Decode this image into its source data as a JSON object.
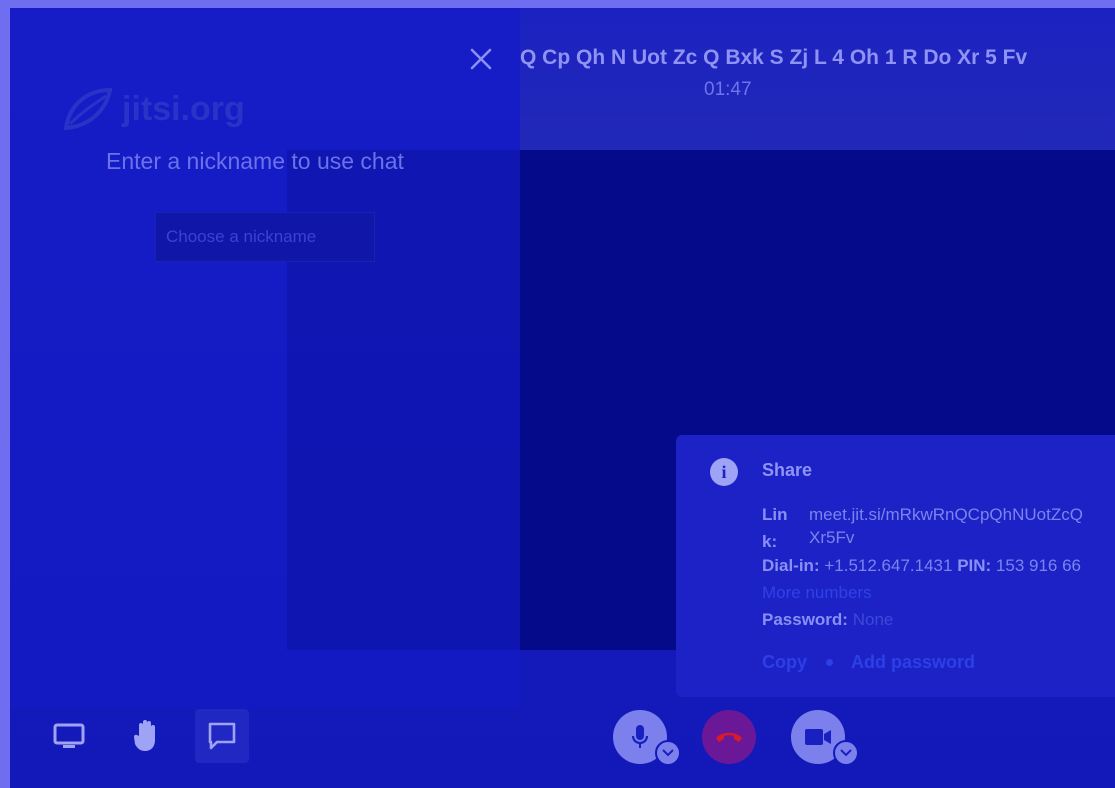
{
  "chat": {
    "logo_text": "jitsi.org",
    "heading": "Enter a nickname to use chat",
    "nickname_placeholder": "Choose a nickname"
  },
  "header": {
    "room_name": "Q Cp Qh N Uot Zc Q Bxk S Zj L 4 Oh 1 R Do Xr 5 Fv",
    "timer": "01:47"
  },
  "share": {
    "title": "Share",
    "link_label": "Lin k:",
    "link_value_line1": "meet.jit.si/mRkwRnQCpQhNUotZcQ",
    "link_value_line2": "Xr5Fv",
    "dialin_label": "Dial-in:",
    "dialin_number": "+1.512.647.1431",
    "pin_label": "PIN:",
    "pin_value": "153 916 66",
    "more_numbers": "More numbers",
    "password_label": "Password:",
    "password_value": "None",
    "copy_label": "Copy",
    "add_password_label": "Add password"
  },
  "icons": {
    "close": "close-icon",
    "info": "info-icon",
    "screen": "screen-share-icon",
    "hand": "raise-hand-icon",
    "chat": "chat-icon",
    "mic": "microphone-icon",
    "hangup": "hangup-icon",
    "camera": "camera-icon",
    "chevron": "chevron-down-icon"
  },
  "colors": {
    "background": "#1319b8",
    "hangup": "#6a1898",
    "link": "#2d3fe6"
  }
}
